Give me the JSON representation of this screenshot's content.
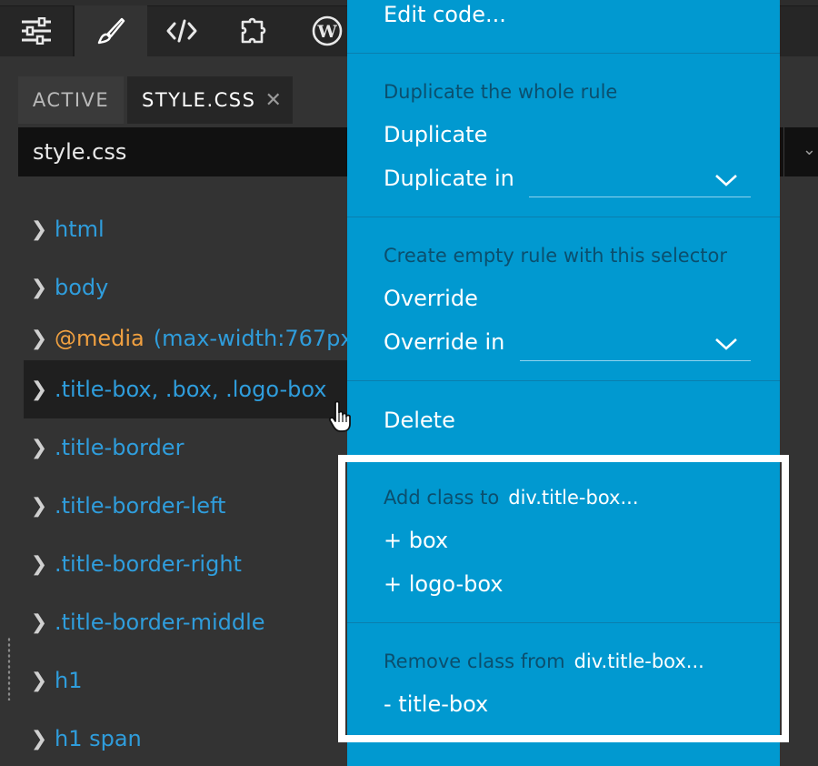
{
  "toolbar": {
    "tools": [
      {
        "icon": "sliders-icon"
      },
      {
        "icon": "brush-icon"
      },
      {
        "icon": "code-icon"
      },
      {
        "icon": "puzzle-icon"
      },
      {
        "icon": "wordpress-icon"
      }
    ]
  },
  "tabs": {
    "active_label": "ACTIVE",
    "file_label": "STYLE.CSS",
    "close_glyph": "✕"
  },
  "file_select": {
    "value": "style.css"
  },
  "rules": [
    {
      "selector": "html"
    },
    {
      "selector": "body"
    },
    {
      "media_keyword": "@media",
      "media_query": "(max-width:767px"
    },
    {
      "selector": ".title-box, .box, .logo-box"
    },
    {
      "selector": ".title-border"
    },
    {
      "selector": ".title-border-left"
    },
    {
      "selector": ".title-border-right"
    },
    {
      "selector": ".title-border-middle"
    },
    {
      "selector": "h1"
    },
    {
      "selector": "h1 span"
    }
  ],
  "menu": {
    "edit_code": "Edit code...",
    "duplicate_heading": "Duplicate the whole rule",
    "duplicate": "Duplicate",
    "duplicate_in": "Duplicate in",
    "create_heading": "Create empty rule with this selector",
    "override": "Override",
    "override_in": "Override in",
    "delete": "Delete",
    "add_class_heading": "Add class to",
    "add_class_target": "div.title-box...",
    "add_box": "+ box",
    "add_logo_box": "+ logo-box",
    "remove_class_heading": "Remove class from",
    "remove_class_target": "div.title-box...",
    "remove_title_box": "- title-box"
  },
  "colors": {
    "menu_bg": "#0199d0",
    "selector_blue": "#2f9ddc",
    "media_orange": "#f0a040",
    "panel_bg": "#333333"
  }
}
